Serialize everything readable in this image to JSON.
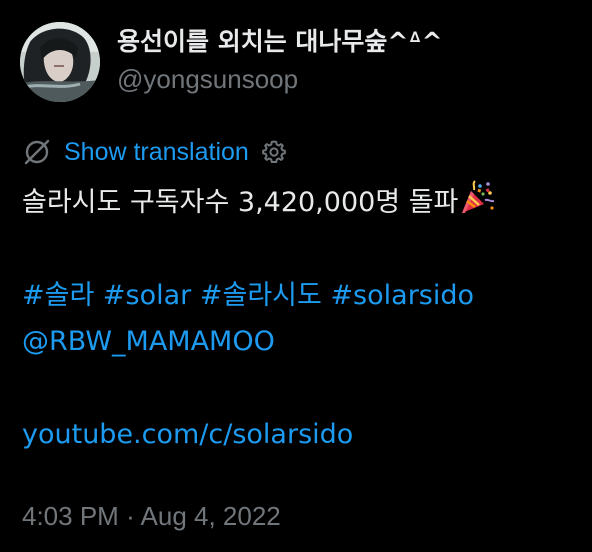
{
  "author": {
    "display_name": "용선이를 외치는 대나무숲^ᐞ^",
    "handle": "@yongsunsoop"
  },
  "translation": {
    "link_label": "Show translation",
    "icons": [
      "globe-slash-icon",
      "gear-icon"
    ]
  },
  "tweet": {
    "line1_text": "솔라시도 구독자수 3,420,000명 돌파",
    "line1_emoji": "party-popper-icon",
    "hashtags": [
      "#솔라",
      "#solar",
      "#솔라시도",
      "#solarsido"
    ],
    "mention": "@RBW_MAMAMOO",
    "link": "youtube.com/c/solarsido"
  },
  "timestamp": {
    "time": "4:03 PM",
    "separator": "·",
    "date": "Aug 4, 2022"
  },
  "colors": {
    "background": "#000000",
    "text": "#e7e9ea",
    "secondary": "#71767b",
    "accent": "#1d9bf0"
  }
}
